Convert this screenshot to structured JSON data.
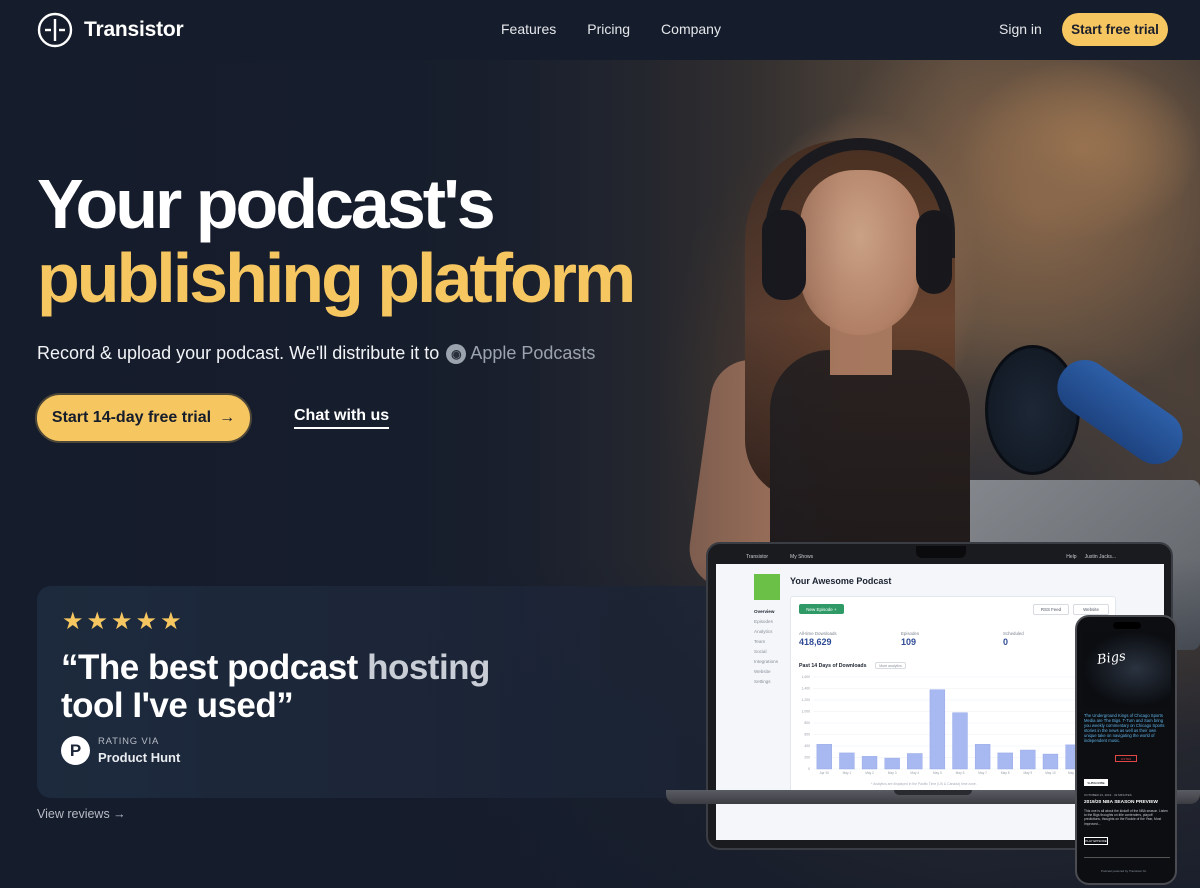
{
  "nav": {
    "brand": "Transistor",
    "links": [
      "Features",
      "Pricing",
      "Company"
    ],
    "sign_in": "Sign in",
    "cta": "Start free trial"
  },
  "hero": {
    "title_line1": "Your podcast's",
    "title_line2": "publishing platform",
    "subtitle": "Record & upload your podcast. We'll distribute it to",
    "distribution_target": "Apple Podcasts",
    "cta_primary": "Start 14-day free trial",
    "cta_secondary": "Chat with us"
  },
  "review": {
    "stars": 5,
    "quote_open": "“The best podcast ",
    "quote_highlight": "hosting",
    "quote_rest": "tool I've used”",
    "rating_via": "RATING VIA",
    "source": "Product Hunt",
    "view_reviews": "View reviews →"
  },
  "dashboard": {
    "topbar_brand": "Transistor",
    "topbar_shows": "My Shows",
    "topbar_help": "Help",
    "topbar_user": "Justin Jacks...",
    "podcast_title": "Your Awesome Podcast",
    "sidebar": [
      "Overview",
      "Episodes",
      "Analytics",
      "Team",
      "Social",
      "Integrations",
      "Website",
      "Settings"
    ],
    "new_episode": "New Episode +",
    "rss_feed": "RSS Feed",
    "website": "Website",
    "stats": [
      {
        "label": "All-time Downloads",
        "value": "418,629"
      },
      {
        "label": "Episodes",
        "value": "109"
      },
      {
        "label": "Scheduled",
        "value": "0"
      }
    ],
    "chart_title": "Past 14 Days of Downloads",
    "chart_select": "More analytics",
    "chart_footnote": "* Analytics are displayed in the Pacific Time (US & Canada) time zone."
  },
  "chart_data": {
    "type": "bar",
    "title": "Past 14 Days of Downloads",
    "categories": [
      "Apr 30",
      "May 1",
      "May 2",
      "May 3",
      "May 4",
      "May 5",
      "May 6",
      "May 7",
      "May 8",
      "May 9",
      "May 10",
      "May 11",
      "May 12"
    ],
    "values": [
      430,
      280,
      220,
      190,
      270,
      1380,
      980,
      430,
      280,
      330,
      260,
      420,
      1380
    ],
    "ylim": [
      0,
      1600
    ],
    "yticks": [
      "0",
      "200",
      "400",
      "600",
      "800",
      "1,000",
      "1,200",
      "1,400",
      "1,600"
    ],
    "color": "#a8b8f0"
  },
  "phone": {
    "headline": "The Underground Kings of Chicago Sports Media are The Bigs. T-Turn and Sam bring you weekly commentary on Chicago Sports stories in the news as well as their own unique take on navigating the world of independent music.",
    "subscribe_btn": "SUBSCRIBE",
    "listen_btn": "LISTEN",
    "episode_meta": "OCTOBER 23, 2019 · 32 MINUTES",
    "episode_title": "2019/20 NBA SEASON PREVIEW",
    "episode_desc": "This one is all about the kickoff of the NBA season. Listen to the Bigs thoughts on title contenders, playoff predictions, thoughts on the Rookie of the Year, Most Improved...",
    "play_btn": "PLAY EPISODE",
    "credit": "Podcast powered by Transistor.fm"
  },
  "colors": {
    "background": "#151c2b",
    "accent": "#f6c661",
    "bar": "#a8b8f0",
    "stat_value": "#2f4b95"
  }
}
